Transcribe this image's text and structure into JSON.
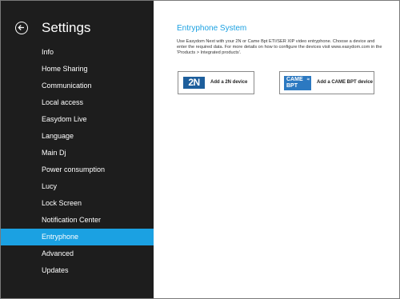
{
  "sidebar": {
    "title": "Settings",
    "items": [
      {
        "label": "Info"
      },
      {
        "label": "Home Sharing"
      },
      {
        "label": "Communication"
      },
      {
        "label": "Local access"
      },
      {
        "label": "Easydom Live"
      },
      {
        "label": "Language"
      },
      {
        "label": "Main Dj"
      },
      {
        "label": "Power consumption"
      },
      {
        "label": "Lucy"
      },
      {
        "label": "Lock Screen"
      },
      {
        "label": "Notification Center"
      },
      {
        "label": "Entryphone",
        "active": true
      },
      {
        "label": "Advanced"
      },
      {
        "label": "Updates"
      }
    ]
  },
  "content": {
    "title": "Entryphone System",
    "description": "Use Easydom Next with your 2N or Came Bpt ETI/SER XIP video entryphone. Choose a device and enter the required data. For more details on how to configure the devices visit www.easydom.com in the 'Products > Integrated products'.",
    "devices": [
      {
        "label": "Add a 2N device",
        "logo_text": "2N"
      },
      {
        "label": "Add a CAME BPT device",
        "logo_line1": "CAME",
        "logo_line2": "BPT"
      }
    ]
  },
  "colors": {
    "accent": "#1ba1e2",
    "sidebar_bg": "#1d1d1d",
    "logo_2n": "#1d5e9c",
    "logo_came": "#2c79c1"
  },
  "icons": {
    "back": "back-arrow-circle-icon"
  }
}
